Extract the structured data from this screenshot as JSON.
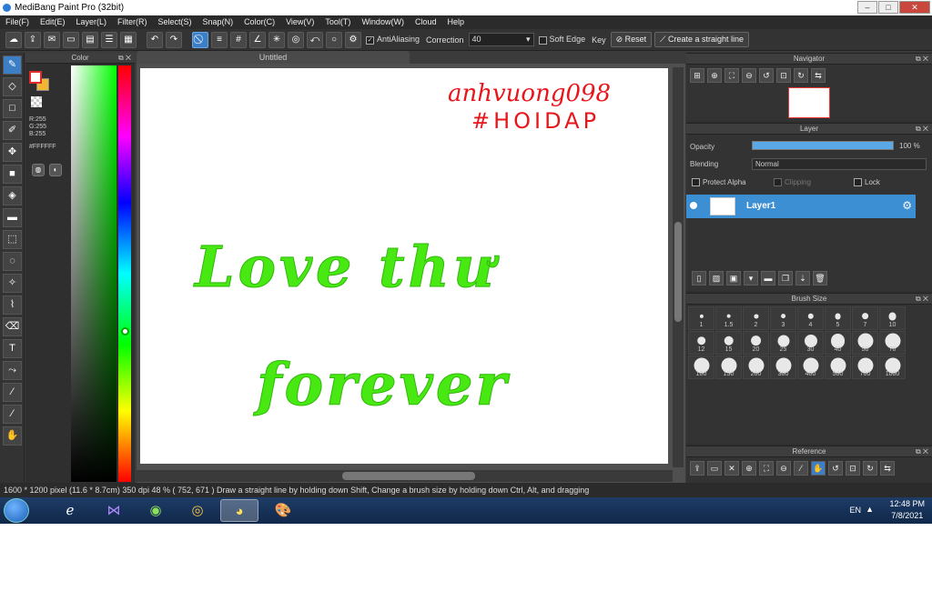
{
  "window": {
    "title": "MediBang Paint Pro (32bit)"
  },
  "menu": [
    "File(F)",
    "Edit(E)",
    "Layer(L)",
    "Filter(R)",
    "Select(S)",
    "Snap(N)",
    "Color(C)",
    "View(V)",
    "Tool(T)",
    "Window(W)",
    "Cloud",
    "Help"
  ],
  "toolbar": {
    "antialias_label": "AntiAliasing",
    "correction_label": "Correction",
    "correction_value": "40",
    "soft_edge_label": "Soft Edge",
    "key_label": "Key",
    "reset_label": "Reset",
    "straight_line_label": "Create a straight line"
  },
  "color_panel": {
    "title": "Color",
    "r": "R:255",
    "g": "G:255",
    "b": "B:255",
    "hex": "#FFFFFF",
    "main_color": "#ffffff",
    "sub_color": "#f1b632"
  },
  "document": {
    "tab": "Untitled",
    "annotation_line1": "anhvuong098",
    "annotation_line2": "#HOIDAP",
    "art_line1": "Love thư",
    "art_line2": "forever"
  },
  "navigator": {
    "title": "Navigator"
  },
  "layer": {
    "title": "Layer",
    "opacity_label": "Opacity",
    "opacity_value": "100 %",
    "opacity_fraction": 1.0,
    "blending_label": "Blending",
    "blending_value": "Normal",
    "protect_alpha": "Protect Alpha",
    "clipping": "Clipping",
    "lock": "Lock",
    "layer_name": "Layer1"
  },
  "brush_size": {
    "title": "Brush Size",
    "sizes": [
      "1",
      "1.5",
      "2",
      "3",
      "4",
      "5",
      "7",
      "10",
      "12",
      "15",
      "20",
      "25",
      "30",
      "40",
      "50",
      "70",
      "100",
      "150",
      "200",
      "300",
      "400",
      "500",
      "700",
      "1000"
    ]
  },
  "reference": {
    "title": "Reference"
  },
  "status": {
    "text": "1600 * 1200 pixel   (11.6 * 8.7cm)   350 dpi   48 %   ( 752, 671 )   Draw a straight line by holding down Shift, Change a brush size by holding down Ctrl, Alt, and dragging"
  },
  "taskbar": {
    "lang": "EN",
    "time": "12:48 PM",
    "date": "7/8/2021"
  }
}
